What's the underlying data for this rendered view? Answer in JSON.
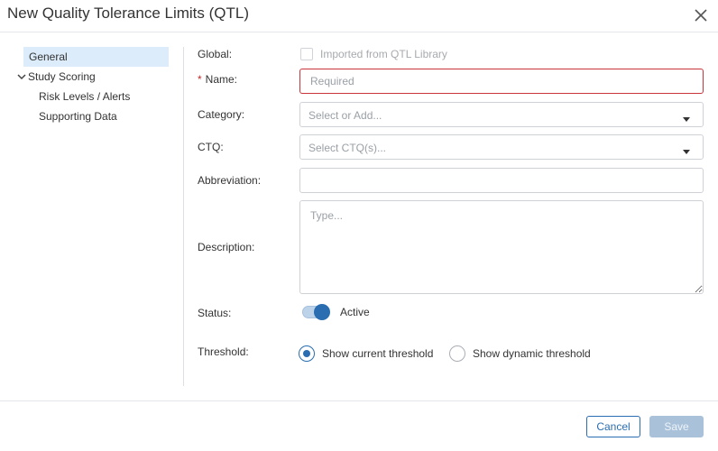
{
  "dialog": {
    "title": "New Quality Tolerance Limits (QTL)",
    "close_icon": "close-icon"
  },
  "sidebar": {
    "items": [
      {
        "label": "General",
        "selected": true
      },
      {
        "label": "Study Scoring",
        "expanded": true,
        "icon": "chevron-down-icon"
      },
      {
        "label": "Risk Levels / Alerts"
      },
      {
        "label": "Supporting Data"
      }
    ]
  },
  "form": {
    "global": {
      "label": "Global:",
      "checkbox_label": "Imported from QTL Library",
      "checked": false
    },
    "name": {
      "required_mark": "*",
      "label": "Name:",
      "value": "",
      "placeholder": "Required"
    },
    "category": {
      "label": "Category:",
      "placeholder": "Select or Add..."
    },
    "ctq": {
      "label": "CTQ:",
      "placeholder": "Select CTQ(s)..."
    },
    "abbreviation": {
      "label": "Abbreviation:",
      "value": "",
      "placeholder": ""
    },
    "description": {
      "label": "Description:",
      "value": "",
      "placeholder": "Type..."
    },
    "status": {
      "label": "Status:",
      "toggle_label": "Active",
      "on": true
    },
    "threshold": {
      "label": "Threshold:",
      "options": [
        {
          "label": "Show current threshold",
          "checked": true
        },
        {
          "label": "Show dynamic threshold",
          "checked": false
        }
      ]
    }
  },
  "footer": {
    "cancel_label": "Cancel",
    "save_label": "Save"
  },
  "colors": {
    "accent": "#2a6db0",
    "selected_bg": "#dcecfa",
    "error_border": "#c8343a",
    "disabled_button": "#a9c2da"
  }
}
